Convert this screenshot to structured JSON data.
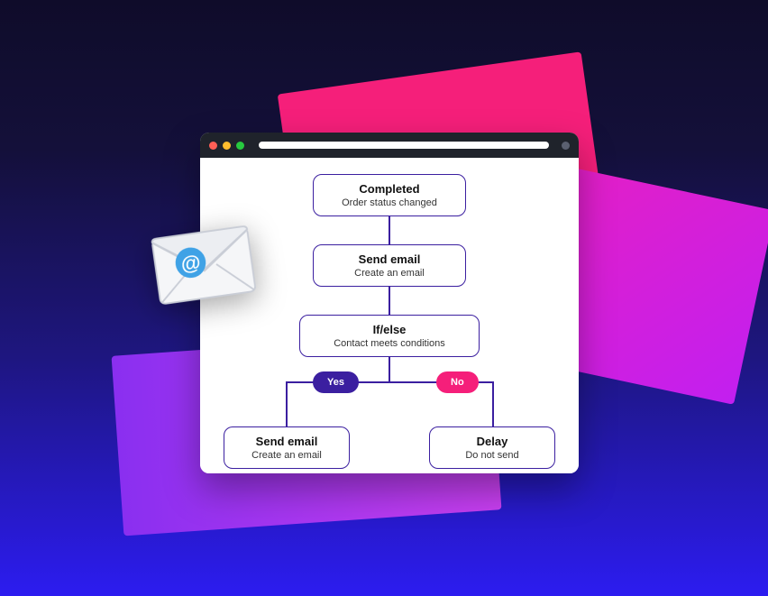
{
  "flow": {
    "n1": {
      "title": "Completed",
      "sub": "Order status changed"
    },
    "n2": {
      "title": "Send email",
      "sub": "Create an email"
    },
    "n3": {
      "title": "If/else",
      "sub": "Contact meets conditions"
    },
    "yes": "Yes",
    "no": "No",
    "n4": {
      "title": "Send email",
      "sub": "Create an email"
    },
    "n5": {
      "title": "Delay",
      "sub": "Do not send"
    }
  },
  "colors": {
    "accent": "#3b1fa0",
    "branchYes": "#3b1fa0",
    "branchNo": "#f51f7a"
  }
}
